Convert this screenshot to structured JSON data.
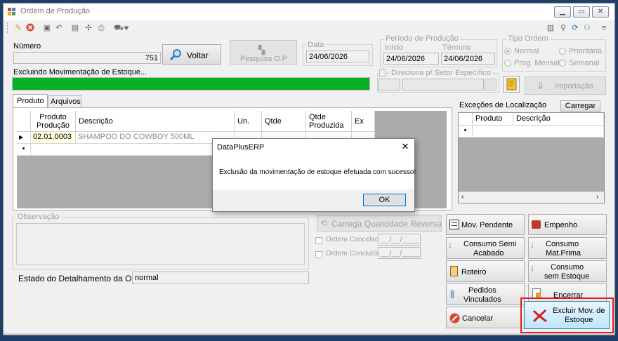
{
  "window": {
    "title": "Ordem de Produção"
  },
  "toolbar_icons": [
    "new-icon",
    "cancel-icon",
    "save-icon",
    "undo-icon",
    "copy-icon",
    "tools-icon",
    "print-icon",
    "options-icon"
  ],
  "right_toolbar_icons": [
    "clipboard-icon",
    "search-icon",
    "refresh-icon",
    "user-icon",
    "menu-icon"
  ],
  "numero": {
    "label": "Número",
    "value": "751"
  },
  "voltar_button": "Voltar",
  "pesquisa_button": "Pesquisa O.P",
  "data": {
    "label": "Data",
    "value": "24/06/2026"
  },
  "periodo": {
    "label": "Período de Produção",
    "inicio_label": "Início",
    "inicio": "24/06/2026",
    "termino_label": "Término",
    "termino": "24/06/2026"
  },
  "tipo_ordem": {
    "label": "Tipo Ordem",
    "options": [
      "Normal",
      "Prioritária",
      "Prog. Mensal",
      "Semanal"
    ],
    "selected": "Normal"
  },
  "progress": {
    "label": "Excluindo Movimentação de Estoque...",
    "percent": 100,
    "color": "#06b025"
  },
  "direciona_label": "Direciona p/ Setor Específico",
  "importacao_button": "Importação",
  "tabs": [
    "Produto",
    "Arquivos"
  ],
  "product_grid": {
    "headers": [
      "Produto Produção",
      "Descrição",
      "Un.",
      "Qtde",
      "Qtde Produzida",
      "Ex"
    ],
    "rows": [
      {
        "produto": "02.01.0003",
        "descricao": "SHAMPOO DO COWBOY  500ML"
      }
    ]
  },
  "excecoes": {
    "label": "Exceções de Localização",
    "carregar_button": "Carregar",
    "headers": [
      "Produto",
      "Descrição"
    ]
  },
  "observacao_label": "Observação",
  "carrega_button": "Carrega Quantidade Reversa",
  "ordem_cancelada": {
    "label": "Ordem Cancelada",
    "value": "__/__/____"
  },
  "ordem_concluida": {
    "label": "Ordem Concluída",
    "value": "__/__/____"
  },
  "estado": {
    "label": "Estado do Detalhamento da OP:",
    "value": "normal"
  },
  "side_buttons": {
    "mov_pendente": "Mov. Pendente",
    "empenho": "Empenho",
    "consumo_semi_1": "Consumo Semi",
    "consumo_semi_2": "Acabado",
    "consumo_mat_1": "Consumo",
    "consumo_mat_2": "Mat.Prima",
    "roteiro": "Roteiro",
    "consumo_sem_1": "Consumo",
    "consumo_sem_2": "sem Estoque",
    "pedidos_1": "Pedidos",
    "pedidos_2": "Vinculados",
    "encerrar": "Encerrar",
    "cancelar": "Cancelar",
    "excluir_1": "Excluir Mov. de",
    "excluir_2": "Estoque"
  },
  "dialog": {
    "title": "DataPlusERP",
    "message": "Exclusão da movimentação de estoque efetuada com sucesso!",
    "ok": "OK"
  }
}
